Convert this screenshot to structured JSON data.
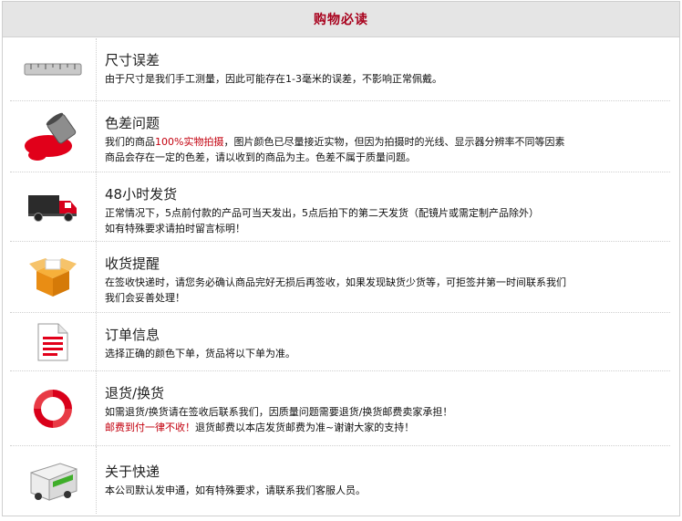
{
  "header": {
    "title": "购物必读"
  },
  "items": [
    {
      "icon": "ruler-icon",
      "title": "尺寸误差",
      "lines": [
        "由于尺寸是我们手工测量，因此可能存在1-3毫米的误差，不影响正常佩戴。"
      ]
    },
    {
      "icon": "paint-bucket-icon",
      "title": "色差问题",
      "line1_prefix": "我们的商品",
      "line1_highlight": "100%实物拍摄",
      "line1_suffix": "，图片颜色已尽量接近实物，但因为拍摄时的光线、显示器分辨率不同等因素",
      "line2": "商品会存在一定的色差，请以收到的商品为主。色差不属于质量问题。"
    },
    {
      "icon": "truck-icon",
      "title": "48小时发货",
      "lines": [
        "正常情况下，5点前付款的产品可当天发出，5点后拍下的第二天发货（配镜片或需定制产品除外）",
        "如有特殊要求请拍时留言标明！"
      ]
    },
    {
      "icon": "package-icon",
      "title": "收货提醒",
      "lines": [
        "在签收快递时，请您务必确认商品完好无损后再签收，如果发现缺货少货等，可拒签并第一时间联系我们",
        "我们会妥善处理！"
      ]
    },
    {
      "icon": "document-icon",
      "title": "订单信息",
      "lines": [
        "选择正确的颜色下单，货品将以下单为准。"
      ]
    },
    {
      "icon": "refresh-arrows-icon",
      "title": "退货/换货",
      "line1": "如需退货/换货请在签收后联系我们，因质量问题需要退货/换货邮费卖家承担！",
      "line2_highlight": "邮费到付一律不收！",
      "line2_suffix": "退货邮费以本店发货邮费为准~谢谢大家的支持！"
    },
    {
      "icon": "delivery-van-icon",
      "title": "关于快递",
      "lines": [
        "本公司默认发申通，如有特殊要求，请联系我们客服人员。"
      ]
    }
  ]
}
